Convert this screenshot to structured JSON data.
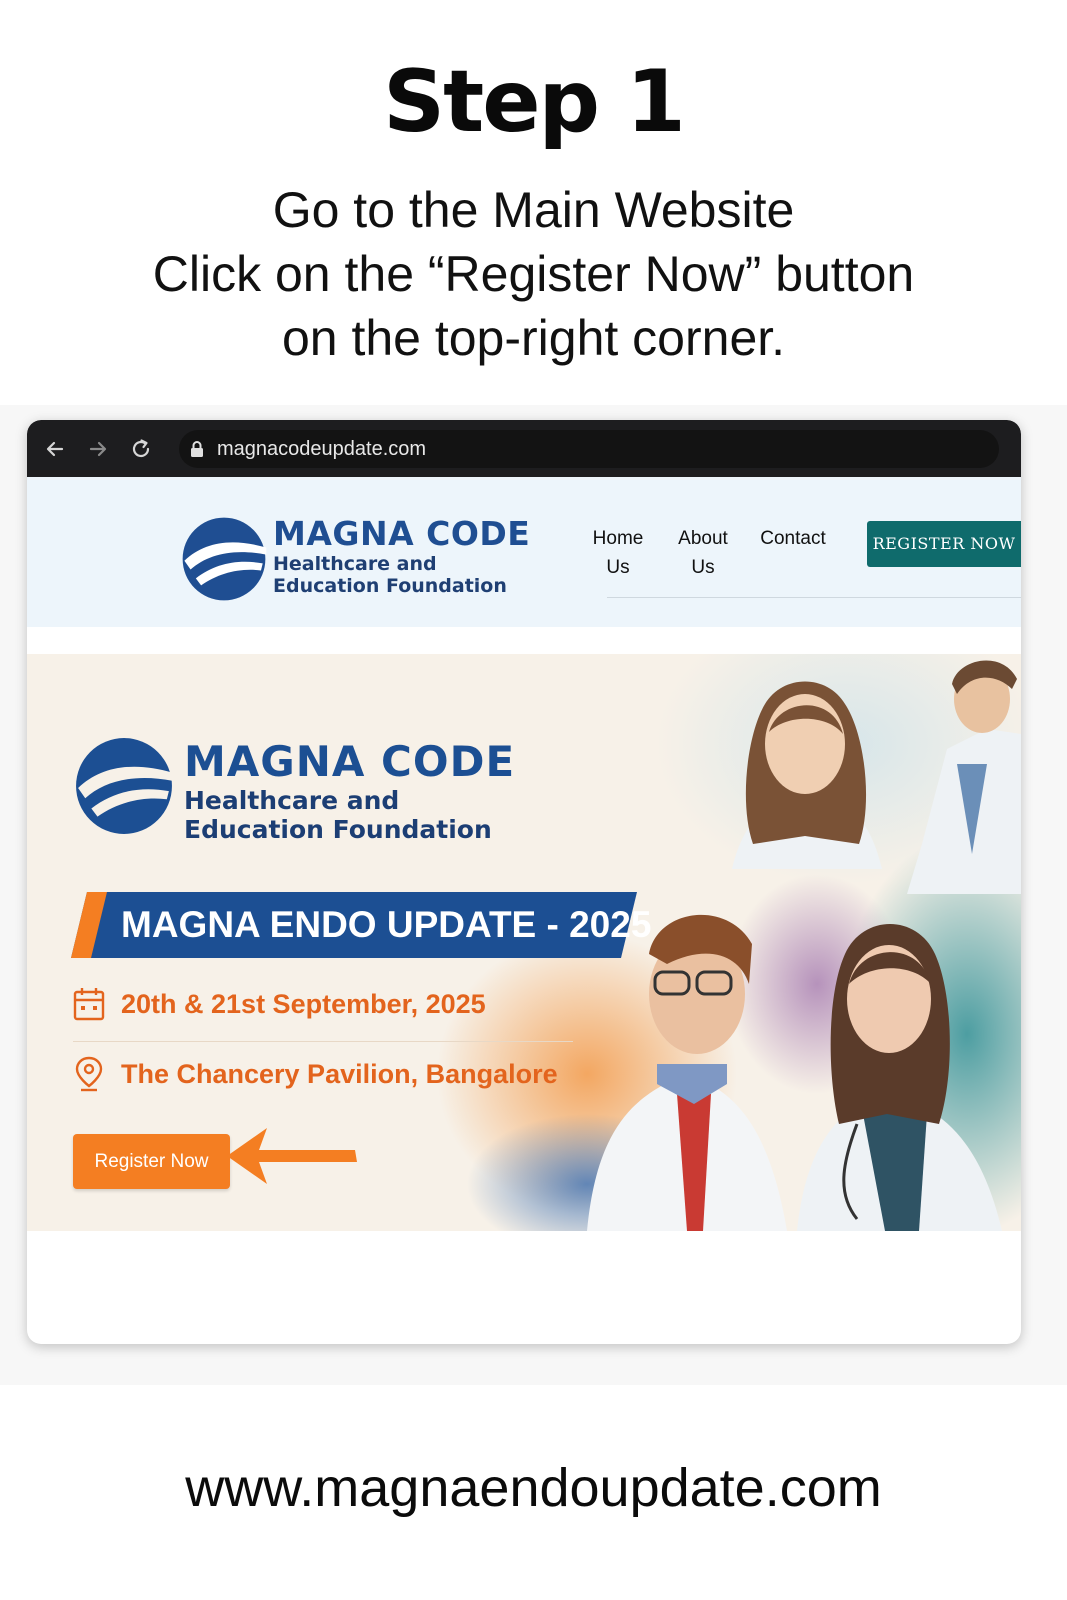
{
  "step": {
    "title": "Step 1"
  },
  "instructions": [
    "Go to the Main Website",
    "Click on the “Register Now” button",
    "on the top-right corner."
  ],
  "browser": {
    "url": "magnacodeupdate.com",
    "icons": [
      "back-arrow-icon",
      "forward-arrow-icon",
      "reload-icon",
      "lock-icon"
    ]
  },
  "site": {
    "brand": {
      "name": "MAGNA CODE",
      "sub_line1": "Healthcare and",
      "sub_line2": "Education Foundation"
    },
    "nav": [
      {
        "line1": "Home",
        "line2": "Us"
      },
      {
        "line1": "About",
        "line2": "Us"
      },
      {
        "line1": "Contact",
        "line2": ""
      }
    ],
    "register_button": "REGISTER NOW"
  },
  "hero": {
    "event_title": "MAGNA ENDO UPDATE - 2025",
    "date": "20th & 21st September, 2025",
    "venue": "The Chancery Pavilion, Bangalore",
    "register_button": "Register Now"
  },
  "colors": {
    "brand_blue": "#1c4f93",
    "teal_button": "#0f6b6c",
    "orange_accent": "#f47e22",
    "orange_text": "#e3641d",
    "header_bg": "#edf5fb",
    "hero_bg": "#f7f1e8"
  },
  "footer": {
    "url": "www.magnaendoupdate.com"
  }
}
